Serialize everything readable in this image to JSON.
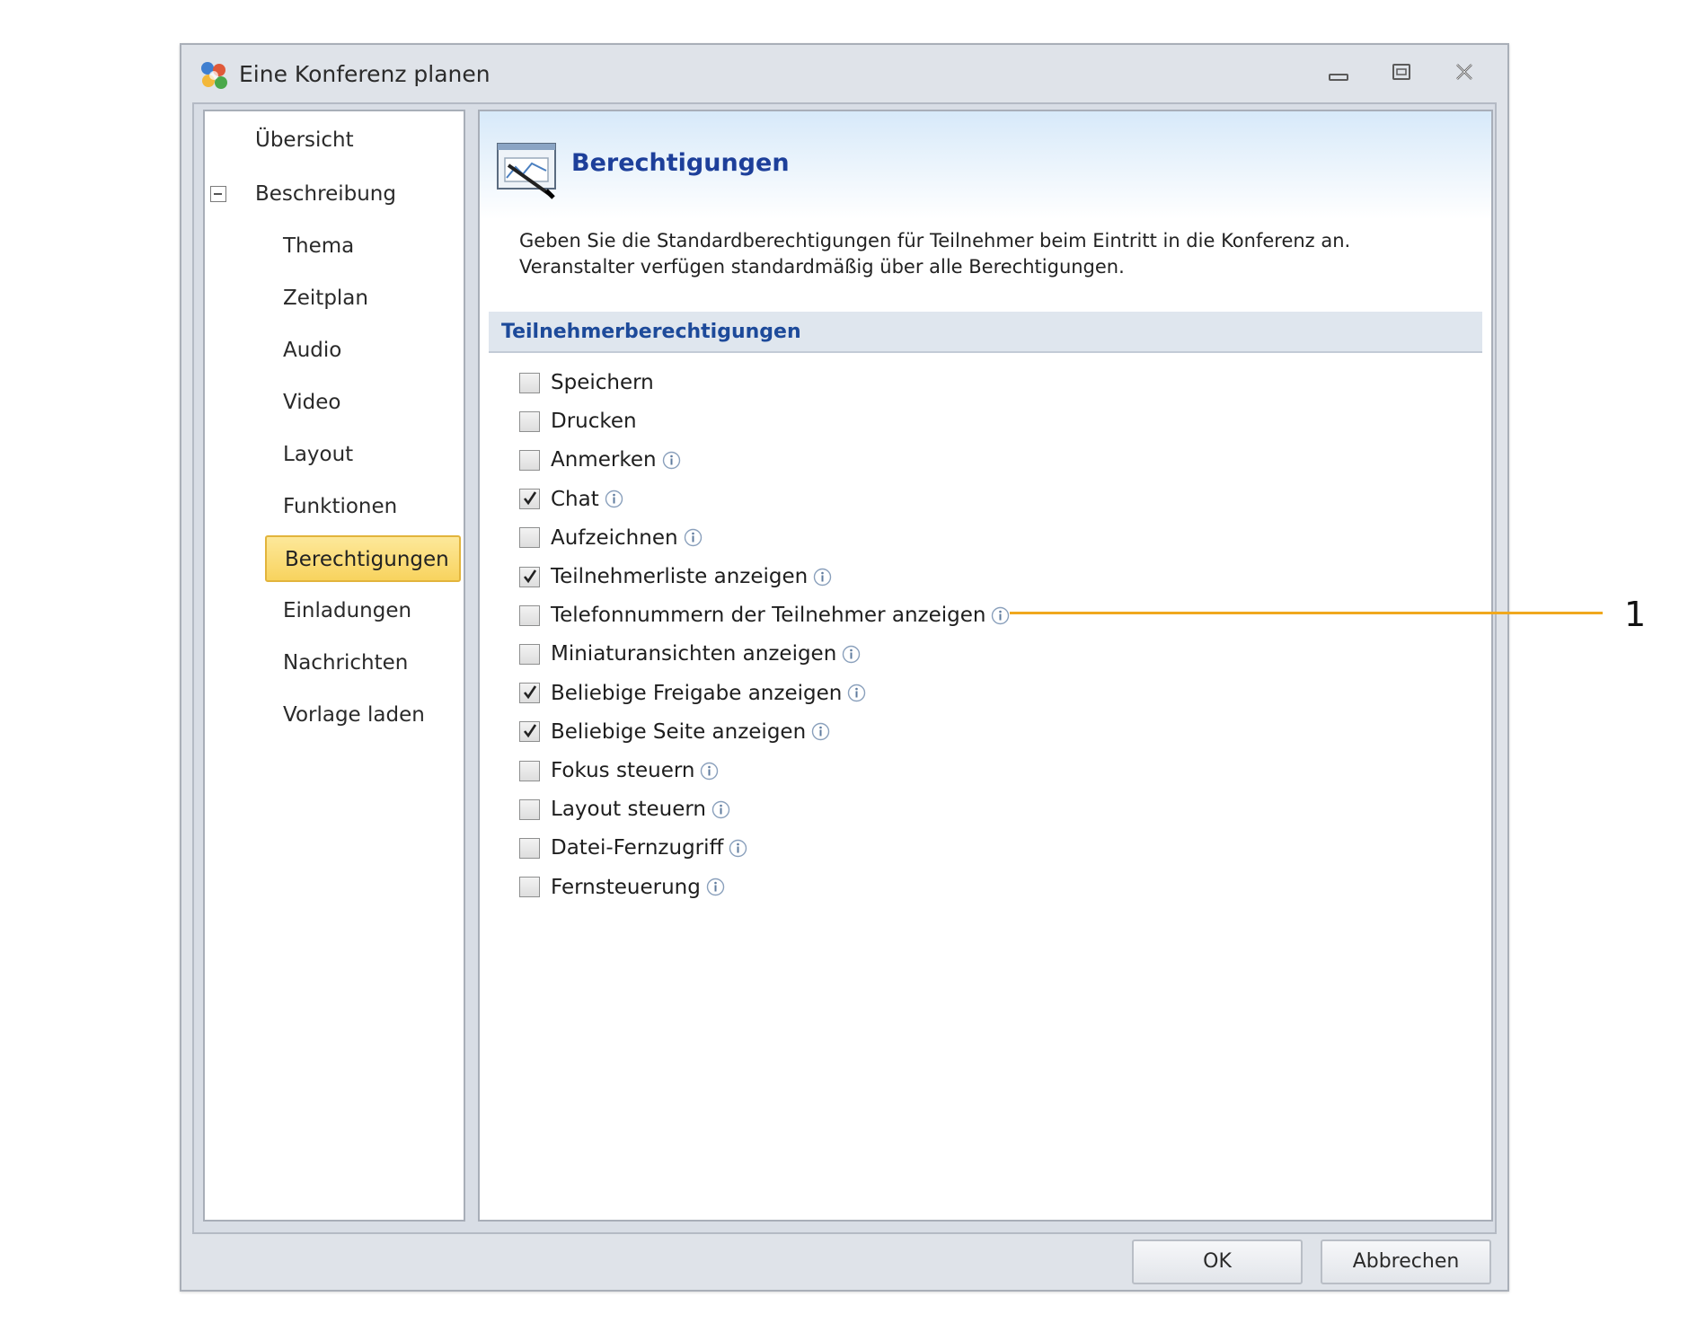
{
  "window": {
    "title": "Eine Konferenz planen",
    "icon": "conference-app-icon",
    "controls": [
      "minimize-icon",
      "maximize-icon",
      "close-icon"
    ]
  },
  "nav": {
    "items": [
      {
        "label": "Übersicht",
        "level": 0
      },
      {
        "label": "Beschreibung",
        "level": 0,
        "expanded": true
      },
      {
        "label": "Thema",
        "level": 1
      },
      {
        "label": "Zeitplan",
        "level": 1
      },
      {
        "label": "Audio",
        "level": 1
      },
      {
        "label": "Video",
        "level": 1
      },
      {
        "label": "Layout",
        "level": 1
      },
      {
        "label": "Funktionen",
        "level": 1
      },
      {
        "label": "Berechtigungen",
        "level": 1,
        "selected": true
      },
      {
        "label": "Einladungen",
        "level": 1
      },
      {
        "label": "Nachrichten",
        "level": 1
      },
      {
        "label": "Vorlage laden",
        "level": 1
      }
    ]
  },
  "content": {
    "title": "Berechtigungen",
    "description_line1": "Geben Sie die Standardberechtigungen für Teilnehmer beim Eintritt in die Konferenz an.",
    "description_line2": "Veranstalter verfügen standardmäßig über alle Berechtigungen.",
    "section_title": "Teilnehmerberechtigungen",
    "permissions": [
      {
        "label": "Speichern",
        "checked": false,
        "info": false
      },
      {
        "label": "Drucken",
        "checked": false,
        "info": false
      },
      {
        "label": "Anmerken",
        "checked": false,
        "info": true
      },
      {
        "label": "Chat",
        "checked": true,
        "info": true
      },
      {
        "label": "Aufzeichnen",
        "checked": false,
        "info": true
      },
      {
        "label": "Teilnehmerliste anzeigen",
        "checked": true,
        "info": true
      },
      {
        "label": "Telefonnummern der Teilnehmer anzeigen",
        "checked": false,
        "info": true
      },
      {
        "label": "Miniaturansichten anzeigen",
        "checked": false,
        "info": true
      },
      {
        "label": "Beliebige Freigabe anzeigen",
        "checked": true,
        "info": true
      },
      {
        "label": "Beliebige Seite anzeigen",
        "checked": true,
        "info": true
      },
      {
        "label": "Fokus steuern",
        "checked": false,
        "info": true
      },
      {
        "label": "Layout steuern",
        "checked": false,
        "info": true
      },
      {
        "label": "Datei-Fernzugriff",
        "checked": false,
        "info": true
      },
      {
        "label": "Fernsteuerung",
        "checked": false,
        "info": true
      }
    ]
  },
  "buttons": {
    "ok": "OK",
    "cancel": "Abbrechen"
  },
  "callout": {
    "number": "1",
    "color": "#f0a81e"
  },
  "colors": {
    "selected_nav_bg": "#f8d35e",
    "title_blue": "#1d3f9a"
  }
}
